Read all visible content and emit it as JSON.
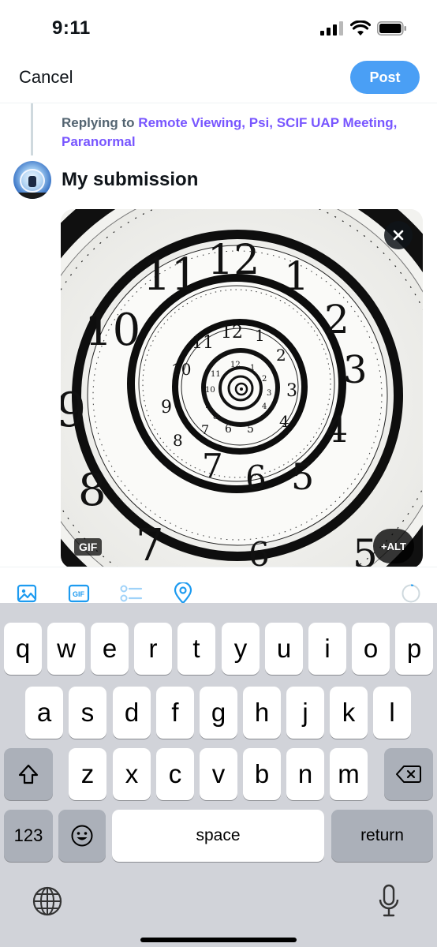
{
  "status_bar": {
    "time": "9:11"
  },
  "compose": {
    "cancel_label": "Cancel",
    "post_label": "Post",
    "replying_prefix": "Replying to",
    "replying_names": "Remote Viewing, Psi, SCIF UAP Meeting, Paranormal",
    "text": "My submission"
  },
  "media": {
    "gif_badge": "GIF",
    "alt_label": "+ALT",
    "close_icon": "close-icon"
  },
  "toolbar": {
    "icons": [
      "image-icon",
      "gif-icon",
      "poll-icon",
      "location-icon"
    ]
  },
  "keyboard": {
    "row1": [
      "q",
      "w",
      "e",
      "r",
      "t",
      "y",
      "u",
      "i",
      "o",
      "p"
    ],
    "row2": [
      "a",
      "s",
      "d",
      "f",
      "g",
      "h",
      "j",
      "k",
      "l"
    ],
    "row3": [
      "z",
      "x",
      "c",
      "v",
      "b",
      "n",
      "m"
    ],
    "numbers_label": "123",
    "space_label": "space",
    "return_label": "return"
  },
  "colors": {
    "accent": "#4a9ff5",
    "mention": "#7856ff",
    "keyboard_bg": "#d1d3d9"
  }
}
